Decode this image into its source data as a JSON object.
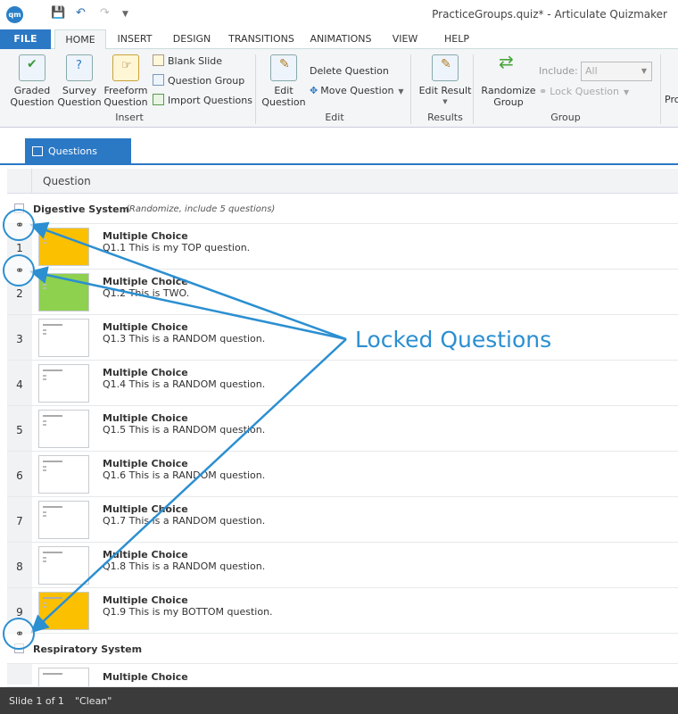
{
  "app": {
    "logo": "qm",
    "window_title": "PracticeGroups.quiz* - Articulate Quizmaker"
  },
  "ribbon_tabs": [
    "FILE",
    "HOME",
    "INSERT",
    "DESIGN",
    "TRANSITIONS",
    "ANIMATIONS",
    "VIEW",
    "HELP"
  ],
  "ribbon": {
    "graded_question": "Graded Question",
    "survey_question": "Survey Question",
    "freeform_question": "Freeform Question",
    "blank_slide": "Blank Slide",
    "question_group": "Question Group",
    "import_questions": "Import Questions",
    "insert_group": "Insert",
    "edit_question": "Edit Question",
    "delete_question": "Delete Question",
    "move_question": "Move Question",
    "edit_group": "Edit",
    "edit_result": "Edit Result",
    "results_group": "Results",
    "randomize_group": "Randomize Group",
    "include_label": "Include:",
    "include_value": "All",
    "lock_question": "Lock Question",
    "group_group": "Group",
    "truncated": "Pro"
  },
  "view_tab": "Questions",
  "column_header": "Question",
  "groups": [
    {
      "name": "Digestive System",
      "note": "(Randomize, include 5 questions)"
    },
    {
      "name": "Respiratory System",
      "note": ""
    }
  ],
  "questions": [
    {
      "num": "1",
      "type": "Multiple Choice",
      "text": "Q1.1 This is my TOP question."
    },
    {
      "num": "2",
      "type": "Multiple Choice",
      "text": "Q1.2 This is TWO."
    },
    {
      "num": "3",
      "type": "Multiple Choice",
      "text": "Q1.3 This is a RANDOM question."
    },
    {
      "num": "4",
      "type": "Multiple Choice",
      "text": "Q1.4 This is a RANDOM question."
    },
    {
      "num": "5",
      "type": "Multiple Choice",
      "text": "Q1.5 This is a RANDOM question."
    },
    {
      "num": "6",
      "type": "Multiple Choice",
      "text": "Q1.6 This is a RANDOM question."
    },
    {
      "num": "7",
      "type": "Multiple Choice",
      "text": "Q1.7 This is a RANDOM question."
    },
    {
      "num": "8",
      "type": "Multiple Choice",
      "text": "Q1.8 This is a RANDOM question."
    },
    {
      "num": "9",
      "type": "Multiple Choice",
      "text": "Q1.9 This is my BOTTOM question."
    }
  ],
  "next_question": {
    "type": "Multiple Choice"
  },
  "callout": "Locked Questions",
  "status": {
    "slide": "Slide 1 of 1",
    "theme": "\"Clean\""
  },
  "colors": {
    "accent": "#2b78c5",
    "callout": "#2b8fd1",
    "orange": "#fbc000",
    "green": "#8ed14f",
    "status_bg": "#3b3b3b"
  }
}
